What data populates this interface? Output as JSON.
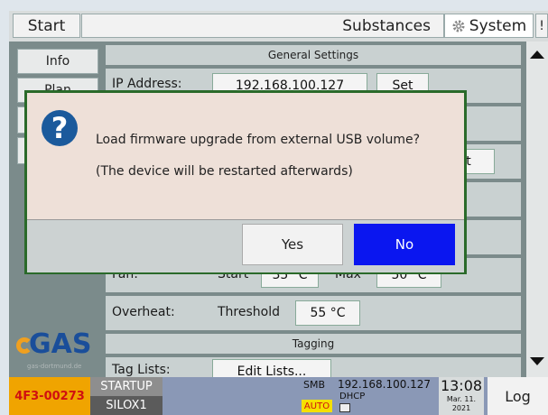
{
  "topbar": {
    "start": "Start",
    "substances": "Substances",
    "system": "System",
    "extra": "!"
  },
  "sidebar": {
    "info": "Info",
    "second": "Plan"
  },
  "general": {
    "section_title": "General Settings",
    "ip_label": "IP Address:",
    "ip_value": "192.168.100.127",
    "set_label": "Set",
    "partial_button": "t"
  },
  "fan": {
    "label": "Fan:",
    "start_label": "Start",
    "start_value": "35 °C",
    "max_label": "Max",
    "max_value": "50 °C"
  },
  "overheat": {
    "label": "Overheat:",
    "threshold_label": "Threshold",
    "threshold_value": "55 °C"
  },
  "tagging": {
    "section_title": "Tagging",
    "tag_lists_label": "Tag Lists:",
    "edit_lists": "Edit Lists..."
  },
  "logo": {
    "text": "GAS",
    "tagline": "gas-dortmund.de"
  },
  "status": {
    "device_id": "4F3-00273",
    "startup": "STARTUP",
    "silo": "SILOX1",
    "smb": "SMB",
    "auto": "AUTO",
    "ip": "192.168.100.127",
    "dhcp": "DHCP",
    "time": "13:08",
    "date": "Mar. 11.",
    "year": "2021",
    "log": "Log"
  },
  "dialog": {
    "message": "Load firmware upgrade from external USB volume?",
    "note": "(The device will be restarted afterwards)",
    "yes": "Yes",
    "no": "No"
  }
}
